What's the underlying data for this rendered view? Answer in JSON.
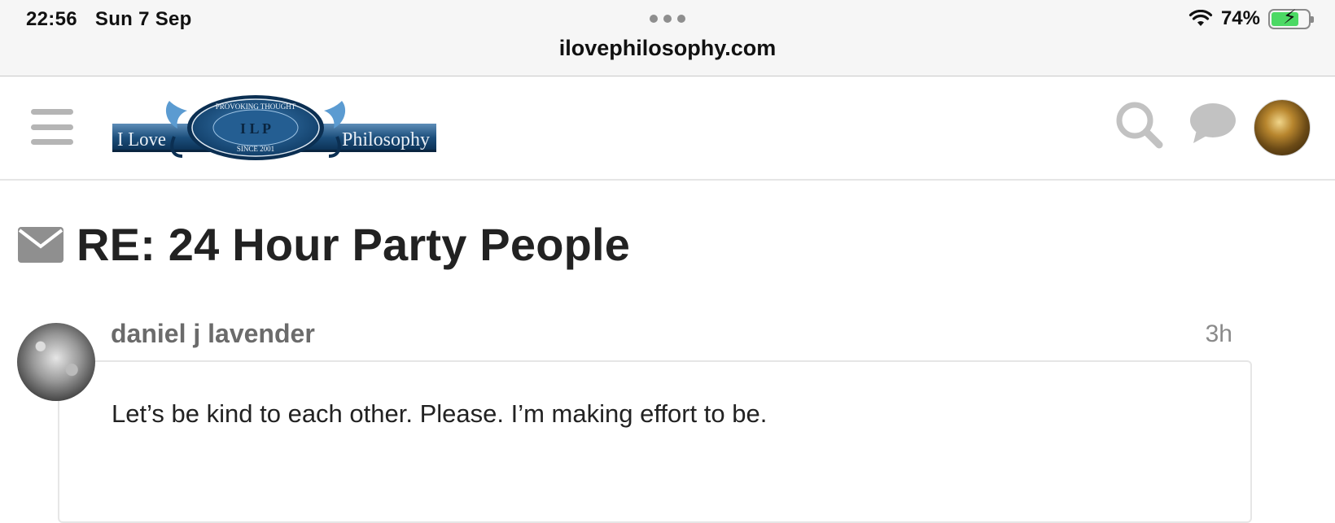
{
  "status_bar": {
    "time": "22:56",
    "date": "Sun 7 Sep",
    "url": "ilovephilosophy.com",
    "battery_percent": "74%",
    "battery_level": 0.74,
    "battery_charging": true
  },
  "header": {
    "logo": {
      "left_text": "I Love",
      "right_text": "Philosophy",
      "oval_top": "PROVOKING THOUGHT",
      "oval_bottom": "SINCE 2001",
      "initials": "I L P"
    },
    "icons": [
      "hamburger-menu-icon",
      "search-icon",
      "chat-icon",
      "user-avatar"
    ]
  },
  "topic": {
    "icon": "envelope-icon",
    "title": "RE: 24 Hour Party People"
  },
  "post": {
    "author": "daniel j lavender",
    "time_ago": "3h",
    "body": "Let’s be kind to each other. Please. I’m making effort to be."
  },
  "colors": {
    "status_bg": "#f6f6f6",
    "logo_blue": "#1f5a8a",
    "icon_gray": "#b5b5b5",
    "battery_green": "#4cd964"
  }
}
